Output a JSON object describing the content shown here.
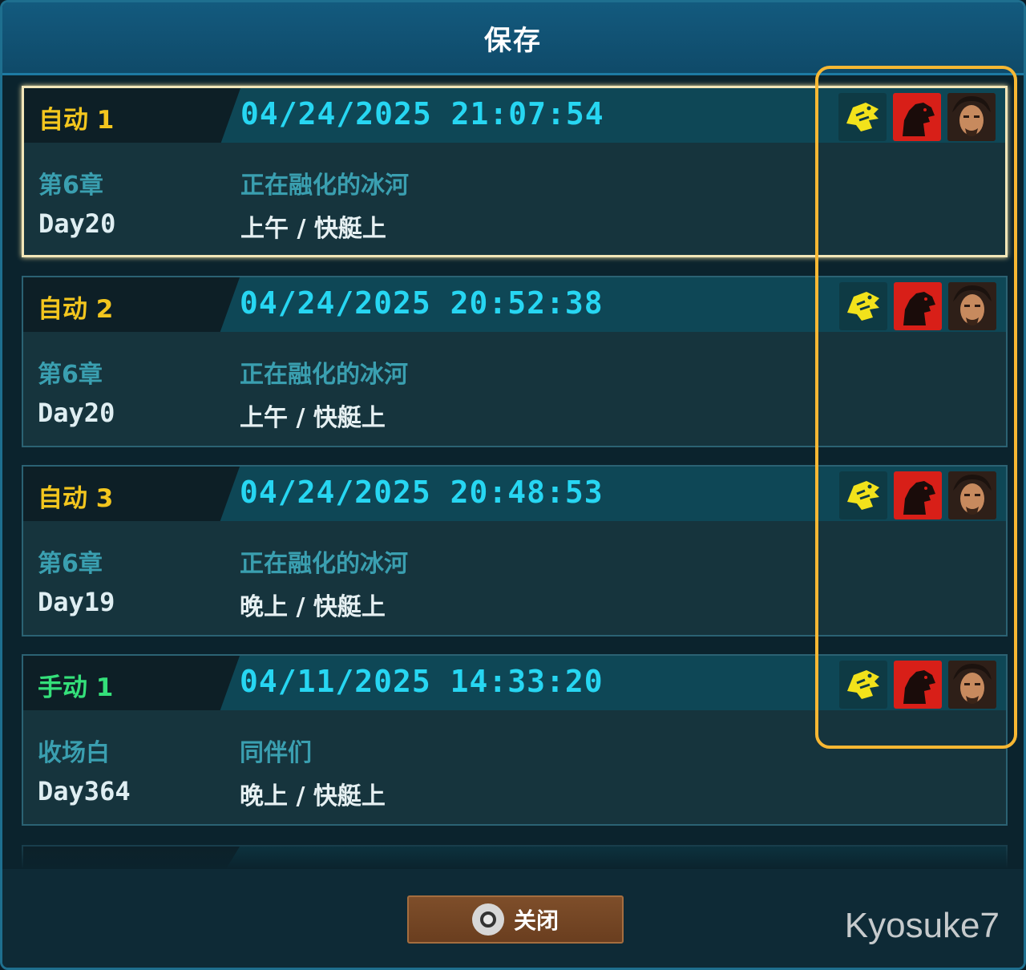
{
  "window": {
    "title": "保存"
  },
  "slots": [
    {
      "name": "自动 1",
      "datetime": "04/24/2025 21:07:54",
      "chapter": "第6章",
      "location": "正在融化的冰河",
      "day": "Day20",
      "time_place": "上午 / 快艇上",
      "kind": "auto",
      "selected": true
    },
    {
      "name": "自动 2",
      "datetime": "04/24/2025 20:52:38",
      "chapter": "第6章",
      "location": "正在融化的冰河",
      "day": "Day20",
      "time_place": "上午 / 快艇上",
      "kind": "auto",
      "selected": false
    },
    {
      "name": "自动 3",
      "datetime": "04/24/2025 20:48:53",
      "chapter": "第6章",
      "location": "正在融化的冰河",
      "day": "Day19",
      "time_place": "晚上 / 快艇上",
      "kind": "auto",
      "selected": false
    },
    {
      "name": "手动 1",
      "datetime": "04/11/2025 14:33:20",
      "chapter": "收场白",
      "location": "同伴们",
      "day": "Day364",
      "time_place": "晚上 / 快艇上",
      "kind": "manual",
      "selected": false
    }
  ],
  "slot_icons": [
    "dragon-emblem-icon",
    "red-monster-icon",
    "character-portrait-icon"
  ],
  "footer": {
    "close_label": "关闭",
    "close_button_icon": "circle-button-icon"
  },
  "watermark": "Kyosuke7",
  "colors": {
    "auto_label": "#f3c61e",
    "manual_label": "#34e07a",
    "datetime": "#27d6f2",
    "highlight_frame": "#f7b733"
  }
}
